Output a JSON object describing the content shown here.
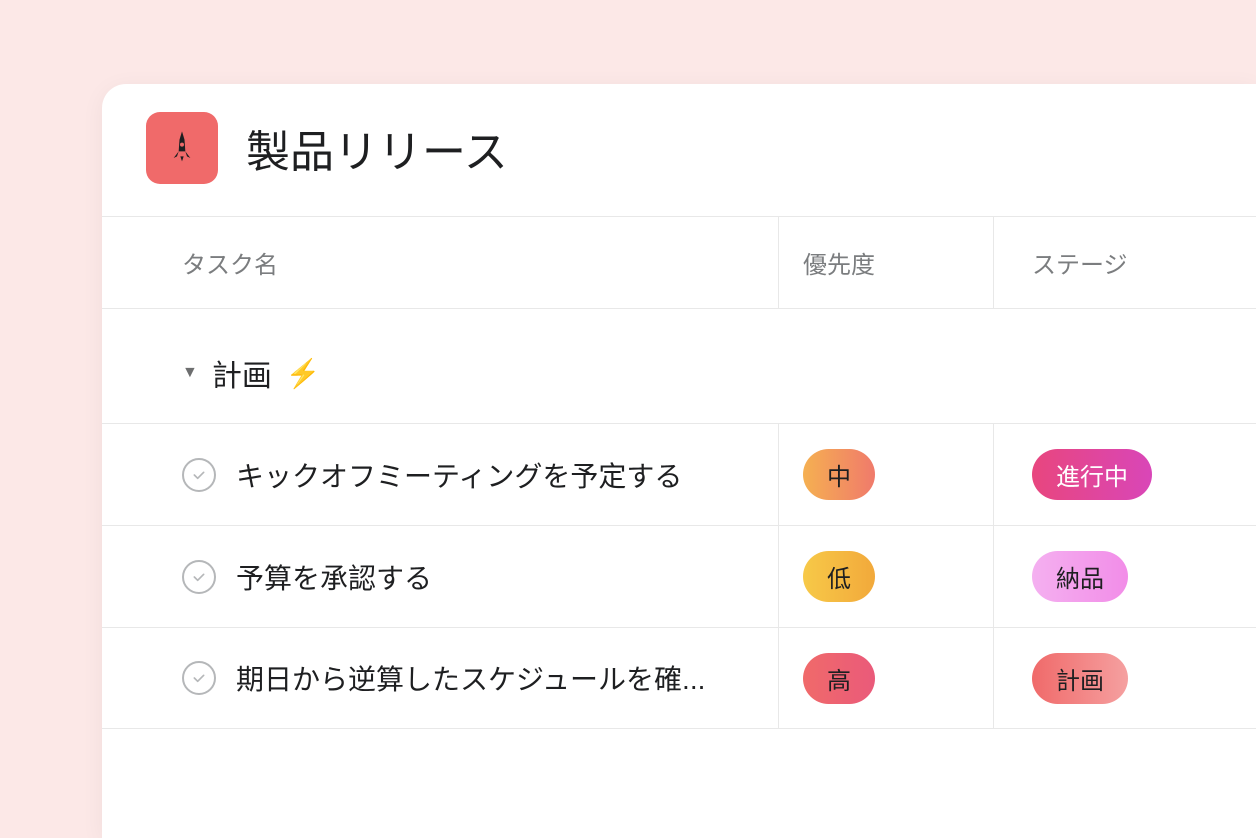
{
  "project": {
    "title": "製品リリース"
  },
  "columns": {
    "task": "タスク名",
    "priority": "優先度",
    "stage": "ステージ"
  },
  "section": {
    "title": "計画"
  },
  "tasks": [
    {
      "name": "キックオフミーティングを予定する",
      "priority": "中",
      "stage": "進行中"
    },
    {
      "name": "予算を承認する",
      "priority": "低",
      "stage": "納品"
    },
    {
      "name": "期日から逆算したスケジュールを確...",
      "priority": "高",
      "stage": "計画"
    }
  ]
}
